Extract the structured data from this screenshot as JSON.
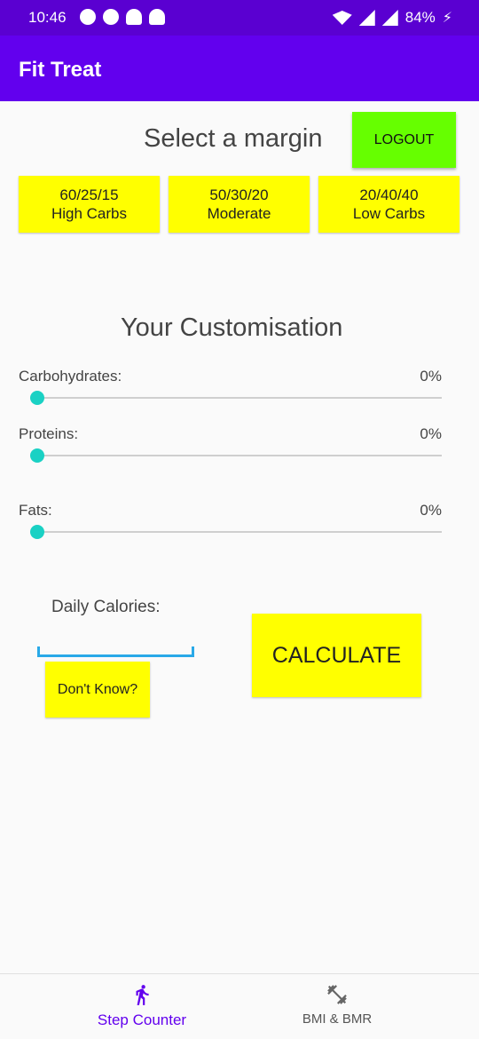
{
  "status_bar": {
    "time": "10:46",
    "battery": "84%"
  },
  "app_bar": {
    "title": "Fit Treat"
  },
  "margin": {
    "title": "Select a margin",
    "logout_label": "LOGOUT",
    "options": [
      {
        "ratio": "60/25/15",
        "name": "High Carbs"
      },
      {
        "ratio": "50/30/20",
        "name": "Moderate"
      },
      {
        "ratio": "20/40/40",
        "name": "Low Carbs"
      }
    ]
  },
  "customisation": {
    "title": "Your Customisation",
    "rows": [
      {
        "label": "Carbohydrates:",
        "value": "0%",
        "level": 0
      },
      {
        "label": "Proteins:",
        "value": "0%",
        "level": 0
      },
      {
        "label": "Fats:",
        "value": "0%",
        "level": 0
      }
    ]
  },
  "calories": {
    "label": "Daily Calories:",
    "value": "",
    "dont_know_label": "Don't Know?",
    "calculate_label": "CALCULATE"
  },
  "bottom_nav": [
    {
      "label": "Step Counter",
      "icon": "walking-person-icon",
      "active": true
    },
    {
      "label": "BMI & BMR",
      "icon": "dumbbell-icon",
      "active": false
    }
  ],
  "colors": {
    "primary": "#6200ee",
    "status_bar": "#5a00d1",
    "accent": "#1ad1c4",
    "button_yellow": "#ffff00",
    "logout_green": "#66ff00"
  }
}
